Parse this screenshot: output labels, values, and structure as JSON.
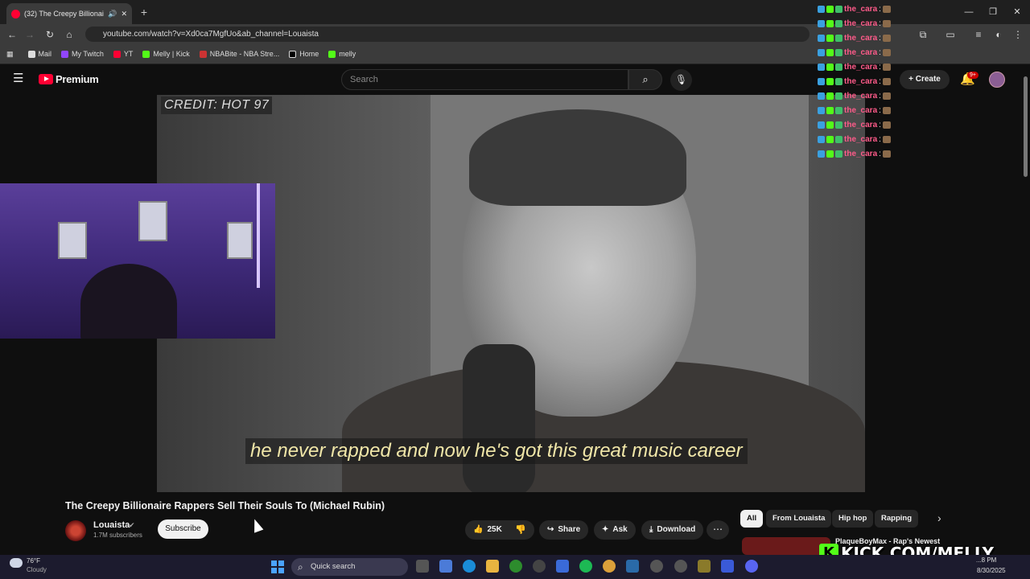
{
  "browser": {
    "tab_title": "(32) The Creepy Billionaire ",
    "url": "youtube.com/watch?v=Xd0ca7MgfUo&ab_channel=Louaista",
    "bookmarks": [
      "Mail",
      "My Twitch",
      "YT",
      "Melly | Kick",
      "NBABite - NBA Stre...",
      "Home",
      "melly"
    ]
  },
  "youtube": {
    "logo_text": "Premium",
    "search_placeholder": "Search",
    "create_label": "Create",
    "notif_count": "9+"
  },
  "video": {
    "credit": "CREDIT: HOT 97",
    "caption": "he never rapped and now he's got this great music career",
    "title": "The Creepy Billionaire Rappers Sell Their Souls To (Michael Rubin)",
    "channel": "Louaista",
    "subscribers": "1.7M subscribers",
    "subscribe_label": "Subscribe",
    "likes": "25K",
    "share_label": "Share",
    "ask_label": "Ask",
    "download_label": "Download"
  },
  "chips": [
    "All",
    "From Louaista",
    "Hip hop",
    "Rapping"
  ],
  "recommended_title": "PlaqueBoyMax - Rap's Newest",
  "chat": {
    "lines": [
      {
        "user": "the_cara",
        "sep": ":"
      },
      {
        "user": "the_cara",
        "sep": ":"
      },
      {
        "user": "the_cara",
        "sep": ":"
      },
      {
        "user": "the_cara",
        "sep": ":"
      },
      {
        "user": "the_cara",
        "sep": ":"
      },
      {
        "user": "the_cara",
        "sep": ":"
      },
      {
        "user": "the_cara",
        "sep": ":"
      },
      {
        "user": "the_cara",
        "sep": ":"
      },
      {
        "user": "the_cara",
        "sep": ":"
      },
      {
        "user": "the_cara",
        "sep": ":"
      },
      {
        "user": "the_cara",
        "sep": ":"
      }
    ]
  },
  "stream_overlay": "KICK.COM/MELLY",
  "taskbar": {
    "temperature": "76°F",
    "condition": "Cloudy",
    "search_label": "Quick search",
    "time": "...8 PM",
    "date": "8/30/2025"
  },
  "colors": {
    "youtube_red": "#ff0033",
    "kick_green": "#53fc18",
    "chat_user": "#ff5b8a"
  }
}
